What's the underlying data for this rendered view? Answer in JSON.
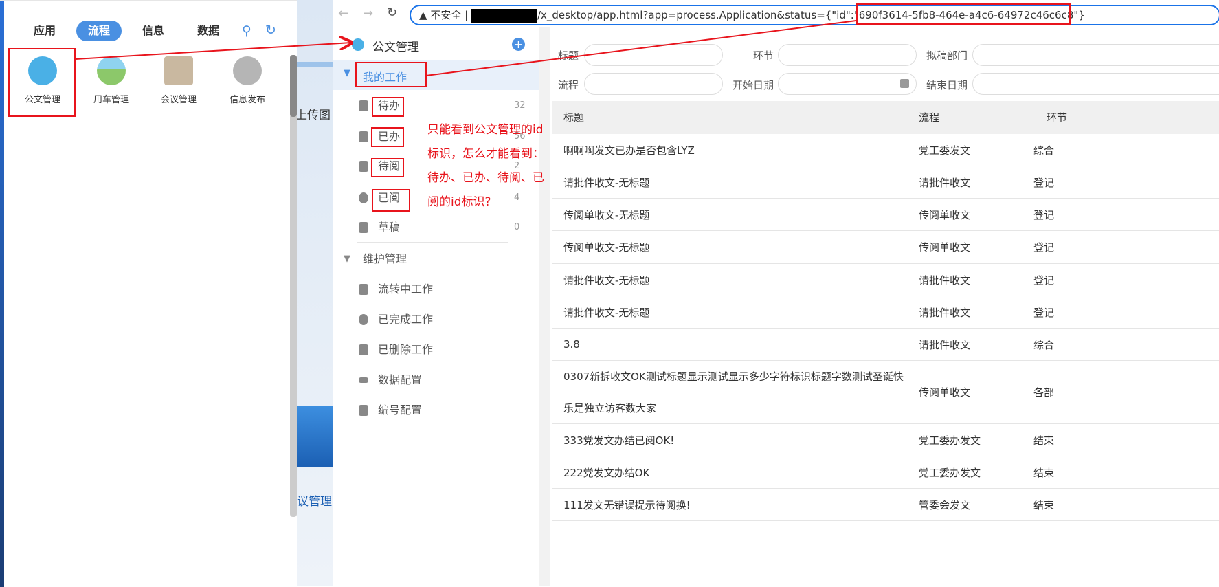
{
  "popup": {
    "tabs": [
      "应用",
      "流程",
      "信息",
      "数据"
    ],
    "active_tab": "流程",
    "apps": [
      {
        "label": "公文管理",
        "color": "#4ab0e6"
      },
      {
        "label": "用车管理",
        "color": "#8cc86a"
      },
      {
        "label": "会议管理",
        "color": "#c9c9c9"
      },
      {
        "label": "信息发布",
        "color": "#b5b5b5"
      }
    ]
  },
  "background_page": {
    "text1": "上传图片",
    "text2": "议管理"
  },
  "browser": {
    "insecure": "不安全",
    "url": "/x_desktop/app.html?app=process.Application&status={\"id\":\"690f3614-5fb8-464e-a4c6-64972c46c6c8\"}"
  },
  "sidebar": {
    "app_title": "公文管理",
    "my_work": "我的工作",
    "work_items": [
      {
        "label": "待办",
        "count": "32"
      },
      {
        "label": "已办",
        "count": "56"
      },
      {
        "label": "待阅",
        "count": "2"
      },
      {
        "label": "已阅",
        "count": "4"
      },
      {
        "label": "草稿",
        "count": "0"
      }
    ],
    "maintenance": "维护管理",
    "maint_items": [
      "流转中工作",
      "已完成工作",
      "已删除工作",
      "数据配置",
      "编号配置"
    ]
  },
  "filters": {
    "title": "标题",
    "step": "环节",
    "dept": "拟稿部门",
    "process": "流程",
    "start": "开始日期",
    "end": "结束日期"
  },
  "table": {
    "headers": [
      "标题",
      "流程",
      "环节"
    ],
    "rows": [
      [
        "啊啊啊发文已办是否包含LYZ",
        "党工委发文",
        "综合"
      ],
      [
        "请批件收文-无标题",
        "请批件收文",
        "登记"
      ],
      [
        "传阅单收文-无标题",
        "传阅单收文",
        "登记"
      ],
      [
        "传阅单收文-无标题",
        "传阅单收文",
        "登记"
      ],
      [
        "请批件收文-无标题",
        "请批件收文",
        "登记"
      ],
      [
        "请批件收文-无标题",
        "请批件收文",
        "登记"
      ],
      [
        "3.8",
        "请批件收文",
        "综合"
      ],
      [
        "0307新拆收文OK测试标题显示测试显示多少字符标识标题字数测试圣诞快乐是独立访客数大家",
        "传阅单收文",
        "各部"
      ],
      [
        "333党发文办结已阅OK!",
        "党工委办发文",
        "结束"
      ],
      [
        "222党发文办结OK",
        "党工委办发文",
        "结束"
      ],
      [
        "111发文无错误提示待阅换!",
        "管委会发文",
        "结束"
      ]
    ]
  },
  "annotation": "只能看到公文管理的id标识，怎么才能看到：待办、已办、待阅、已阅的id标识?"
}
